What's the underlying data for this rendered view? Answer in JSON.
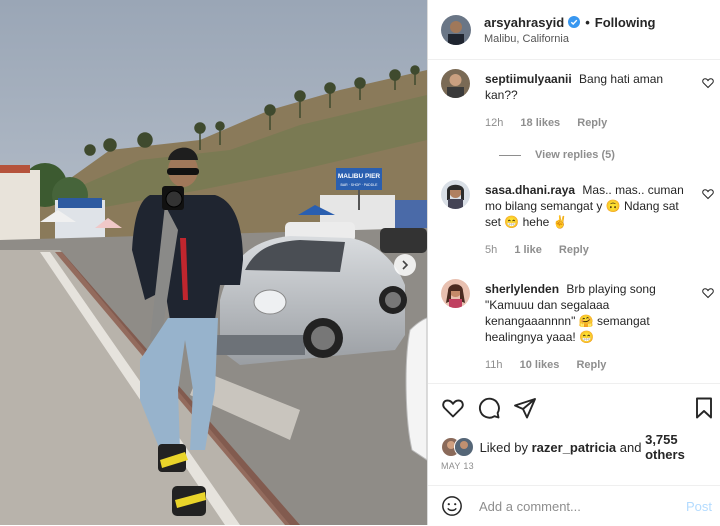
{
  "post": {
    "username": "arsyahrasyid",
    "follow_separator": "•",
    "follow_label": "Following",
    "location": "Malibu, California",
    "sign_text": "MALIBU PIER",
    "sign_subtext": "BAR · SHOP · PADDLE"
  },
  "comments": [
    {
      "username": "septiimulyaanii",
      "text": "Bang hati aman kan??",
      "time": "12h",
      "likes": "18 likes",
      "reply_label": "Reply",
      "view_replies": "View replies (5)"
    },
    {
      "username": "sasa.dhani.raya",
      "text": "Mas.. mas.. cuman mo bilang semangat y 🙃 Ndang sat set 😁 hehe ✌️",
      "time": "5h",
      "likes": "1 like",
      "reply_label": "Reply"
    },
    {
      "username": "sherlylenden",
      "text": "Brb playing song \"Kamuuu dan segalaaa kenangaaannnn\" 🤗 semangat healingnya yaaa! 😁",
      "time": "11h",
      "likes": "10 likes",
      "reply_label": "Reply"
    }
  ],
  "likes": {
    "prefix": "Liked by ",
    "user": "razer_patricia",
    "middle": " and ",
    "count": "3,755 others"
  },
  "date": "MAY 13",
  "comment_box": {
    "placeholder": "Add a comment...",
    "post_label": "Post"
  },
  "colors": {
    "verified": "#3897f0",
    "post_disabled": "#b3dbff",
    "muted": "#8e8e8e"
  },
  "icons": [
    "verified-badge-icon",
    "heart-icon",
    "comment-icon",
    "share-icon",
    "bookmark-icon",
    "emoji-icon",
    "chevron-right-icon"
  ]
}
